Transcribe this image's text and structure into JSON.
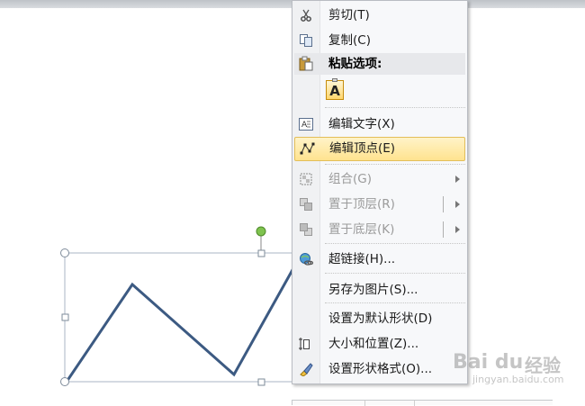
{
  "menu": {
    "items": [
      {
        "label": "剪切(T)",
        "icon": "scissors-icon"
      },
      {
        "label": "复制(C)",
        "icon": "copy-icon"
      },
      {
        "label": "编辑文字(X)",
        "icon": "edit-text-icon"
      },
      {
        "label": "编辑顶点(E)",
        "icon": "edit-points-icon"
      },
      {
        "label": "组合(G)",
        "icon": "group-icon"
      },
      {
        "label": "置于顶层(R)",
        "icon": "bring-to-front-icon"
      },
      {
        "label": "置于底层(K)",
        "icon": "send-to-back-icon"
      },
      {
        "label": "超链接(H)...",
        "icon": "hyperlink-icon"
      },
      {
        "label": "另存为图片(S)..."
      },
      {
        "label": "设置为默认形状(D)"
      },
      {
        "label": "大小和位置(Z)...",
        "icon": "size-position-icon"
      },
      {
        "label": "设置形状格式(O)...",
        "icon": "format-shape-icon"
      }
    ],
    "paste_header": "粘贴选项:",
    "paste_option_label": "A",
    "highlight_color": "#ffe38f"
  },
  "shape": {
    "line_color": "#3c5a82",
    "rotation_handle_color": "#7fc34f"
  },
  "watermark": {
    "logo": "Bai du",
    "cn": "经验",
    "url": "jingyan.baidu.com"
  }
}
